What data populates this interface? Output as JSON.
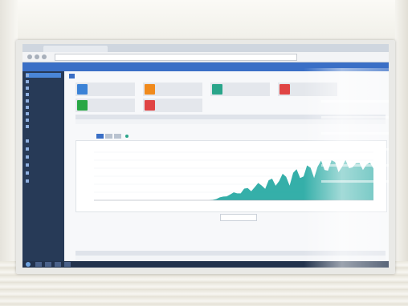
{
  "photo": {
    "wall_color": "#f4f3ee",
    "bezel_color": "#e9e9e6"
  },
  "app": {
    "header_color": "#3a6fc6",
    "sidebar_color": "#273a57",
    "sidebar_active_color": "#4a86d8",
    "sidebar_items": [
      "",
      "",
      "",
      "",
      "",
      "",
      "",
      "",
      "",
      "",
      "",
      "",
      "",
      "",
      ""
    ],
    "page_title": "",
    "cards": [
      {
        "icon": "lightning-icon",
        "color": "#3b82d6",
        "value": "",
        "sub": ""
      },
      {
        "icon": "sun-icon",
        "color": "#f08a1c",
        "value": "",
        "sub": ""
      },
      {
        "icon": "thermometer-icon",
        "color": "#2aa58a",
        "value": "",
        "sub": ""
      },
      {
        "icon": "power-icon",
        "color": "#e04444",
        "value": "",
        "sub": ""
      },
      {
        "icon": "leaf-icon",
        "color": "#29a745",
        "value": "",
        "sub": ""
      },
      {
        "icon": "clock-icon",
        "color": "#e04444",
        "value": "",
        "sub": ""
      }
    ],
    "summary_headers": [
      "",
      "",
      ""
    ],
    "summary_values": [
      "",
      "",
      ""
    ],
    "chart_buttons": [
      "",
      "",
      ""
    ],
    "chart_title": "",
    "date_value": "",
    "table_headers": [
      "",
      "",
      "",
      "",
      ""
    ],
    "table_values": [
      "",
      "",
      "",
      "",
      ""
    ],
    "footer_note": "",
    "series_color": "#1fa6a0"
  }
}
